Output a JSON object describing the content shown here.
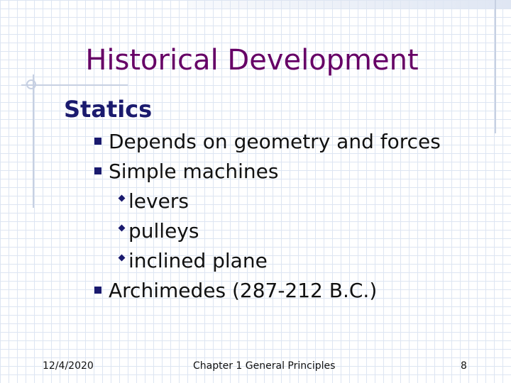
{
  "slide": {
    "title": "Historical Development",
    "subtitle": "Statics",
    "bullets": [
      "Depends on geometry and forces",
      "Simple machines"
    ],
    "sub_bullets": [
      "levers",
      "pulleys",
      "inclined plane"
    ],
    "bullet_last": "Archimedes (287-212 B.C.)"
  },
  "footer": {
    "date": "12/4/2020",
    "center": "Chapter 1 General Principles",
    "page": "8"
  },
  "colors": {
    "title": "#660066",
    "subtitle": "#1a1a6e",
    "bullet": "#1a1a6e",
    "grid": "#dde5f2"
  }
}
